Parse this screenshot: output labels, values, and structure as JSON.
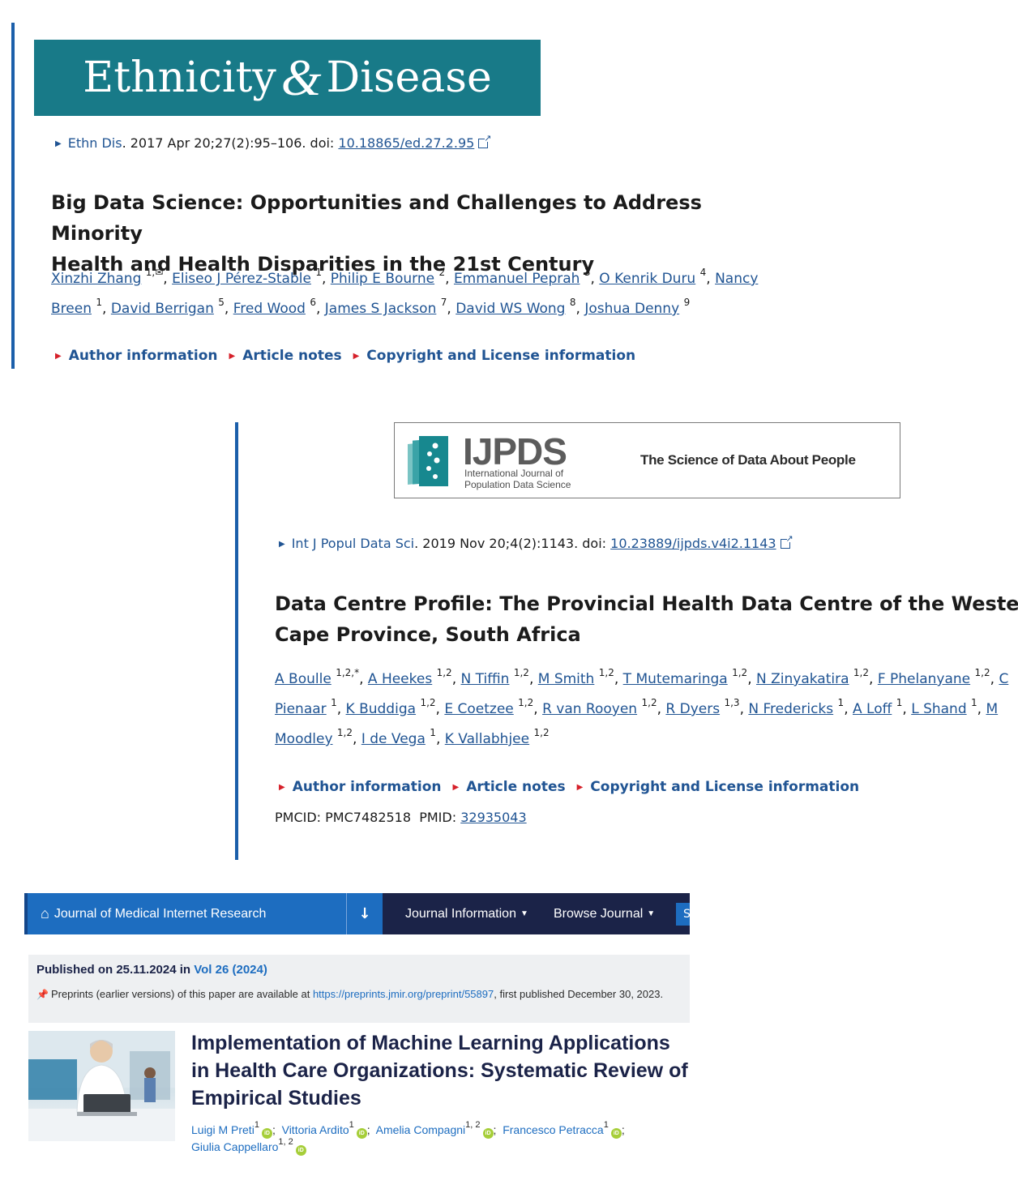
{
  "panel1": {
    "logo": {
      "left": "Ethnicity",
      "amp": "&",
      "right": "Disease"
    },
    "citation": {
      "journal": "Ethn Dis",
      "details": ". 2017 Apr 20;27(2):95–106. doi: ",
      "doi": "10.18865/ed.27.2.95"
    },
    "title_line1": "Big Data Science: Opportunities and Challenges to Address Minority",
    "title_line2": "Health and Health Disparities in the 21st Century",
    "authors": [
      {
        "name": "Xinzhi Zhang",
        "sup": "1,"
      },
      {
        "name": "Eliseo J Pérez-Stable",
        "sup": "1"
      },
      {
        "name": "Philip E Bourne",
        "sup": "2"
      },
      {
        "name": "Emmanuel Peprah",
        "sup": "3"
      },
      {
        "name": "O Kenrik Duru",
        "sup": "4"
      },
      {
        "name": "Nancy",
        "sup": ""
      },
      {
        "name": "Breen",
        "sup": "1"
      },
      {
        "name": "David Berrigan",
        "sup": "5"
      },
      {
        "name": "Fred Wood",
        "sup": "6"
      },
      {
        "name": "James S Jackson",
        "sup": "7"
      },
      {
        "name": "David WS Wong",
        "sup": "8"
      },
      {
        "name": "Joshua Denny",
        "sup": "9"
      }
    ],
    "sections": [
      "Author information",
      "Article notes",
      "Copyright and License information"
    ]
  },
  "panel2": {
    "logo": {
      "name": "IJPDS",
      "sub1": "International Journal of",
      "sub2": "Population Data Science",
      "tagline": "The Science of Data About People"
    },
    "citation": {
      "journal": "Int J Popul Data Sci",
      "details": ". 2019 Nov 20;4(2):1143. doi: ",
      "doi": "10.23889/ijpds.v4i2.1143"
    },
    "title_line1": "Data Centre Profile: The Provincial Health Data Centre of the Western",
    "title_line2": "Cape Province, South Africa",
    "authors": [
      {
        "name": "A Boulle",
        "sup": "1,2,*"
      },
      {
        "name": "A Heekes",
        "sup": "1,2"
      },
      {
        "name": "N Tiffin",
        "sup": "1,2"
      },
      {
        "name": "M Smith",
        "sup": "1,2"
      },
      {
        "name": "T Mutemaringa",
        "sup": "1,2"
      },
      {
        "name": "N Zinyakatira",
        "sup": "1,2"
      },
      {
        "name": "F Phelanyane",
        "sup": "1,2"
      },
      {
        "name": "C",
        "sup": ""
      },
      {
        "name": "Pienaar",
        "sup": "1"
      },
      {
        "name": "K Buddiga",
        "sup": "1,2"
      },
      {
        "name": "E Coetzee",
        "sup": "1,2"
      },
      {
        "name": "R van Rooyen",
        "sup": "1,2"
      },
      {
        "name": "R Dyers",
        "sup": "1,3"
      },
      {
        "name": "N Fredericks",
        "sup": "1"
      },
      {
        "name": "A Loff",
        "sup": "1"
      },
      {
        "name": "L Shand",
        "sup": "1"
      },
      {
        "name": "M",
        "sup": ""
      },
      {
        "name": "Moodley",
        "sup": "1,2"
      },
      {
        "name": "I de Vega",
        "sup": "1"
      },
      {
        "name": "K Vallabhjee",
        "sup": "1,2"
      }
    ],
    "sections": [
      "Author information",
      "Article notes",
      "Copyright and License information"
    ],
    "pmcid_label": "PMCID:",
    "pmcid": "PMC7482518",
    "pmid_label": "PMID:",
    "pmid": "32935043"
  },
  "panel3": {
    "nav": {
      "home": "Journal of Medical Internet Research",
      "journal_info": "Journal Information",
      "browse": "Browse Journal",
      "stub": "S"
    },
    "published_prefix": "Published on 25.11.2024 in",
    "volume": "Vol 26 (2024)",
    "preprint_text": "Preprints (earlier versions) of this paper are available at",
    "preprint_link": "https://preprints.jmir.org/preprint/55897",
    "preprint_suffix": ", first published December 30, 2023.",
    "title": "Implementation of Machine Learning Applications in Health Care Organizations: Systematic Review of Empirical Studies",
    "authors": [
      {
        "name": "Luigi M Preti",
        "sup": "1"
      },
      {
        "name": "Vittoria Ardito",
        "sup": "1"
      },
      {
        "name": "Amelia Compagni",
        "sup": "1, 2"
      },
      {
        "name": "Francesco Petracca",
        "sup": "1"
      },
      {
        "name": "Giulia Cappellaro",
        "sup": "1, 2"
      }
    ]
  }
}
